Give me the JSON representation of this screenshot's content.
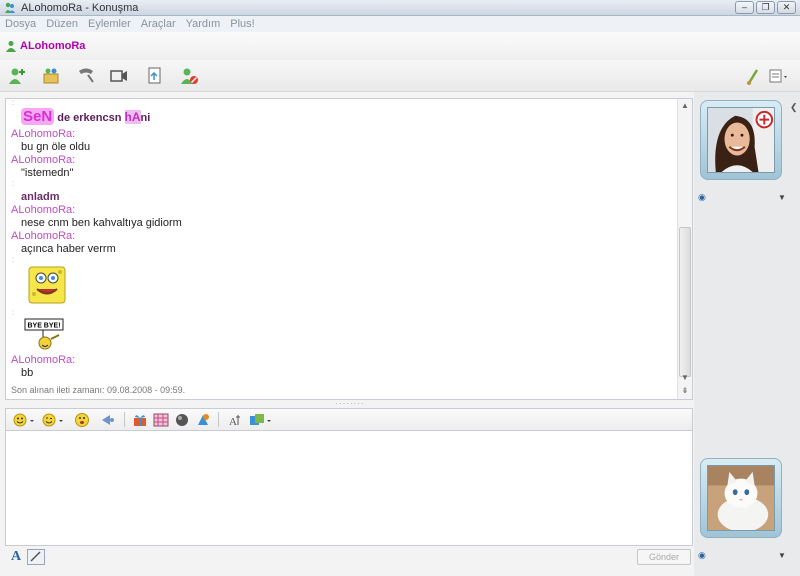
{
  "window": {
    "title": "ALohomoRa - Konuşma"
  },
  "menu": [
    "Dosya",
    "Düzen",
    "Eylemler",
    "Araçlar",
    "Yardım",
    "Plus!"
  ],
  "contact": {
    "name": "ALohomoRa"
  },
  "toolbar": {
    "buttons": [
      "invite-contact",
      "share-files",
      "start-call",
      "video-call",
      "send-file",
      "block-contact"
    ]
  },
  "conversation": {
    "messages": [
      {
        "type": "art",
        "text_art": "SeN",
        "text_rest": " de erkencsn ",
        "text_art2": "hA",
        "text_tail": "ni"
      },
      {
        "type": "sender",
        "text": "ALohomoRa:"
      },
      {
        "type": "msg",
        "text": "bu gn öle oldu"
      },
      {
        "type": "sender",
        "text": "ALohomoRa:"
      },
      {
        "type": "msg",
        "text": "\"istemedn\""
      },
      {
        "type": "msg-bold",
        "text": "anladm"
      },
      {
        "type": "sender",
        "text": "ALohomoRa:"
      },
      {
        "type": "msg",
        "text": "nese cnm ben kahvaltıya gidiorm"
      },
      {
        "type": "sender",
        "text": "ALohomoRa:"
      },
      {
        "type": "msg",
        "text": "açınca haber verrm"
      },
      {
        "type": "sender",
        "text": "ALohomoRa:"
      },
      {
        "type": "msg",
        "text": "bb"
      }
    ],
    "emoticon_sign": "BYE BYE!",
    "last_message_label": "Son alınan ileti zamanı: 09.08.2008 - 09:59."
  },
  "compose": {
    "send_label": "Gönder",
    "font_icon_label": "A"
  },
  "colors": {
    "sender": "#c04cc4",
    "contact_name": "#b000b0"
  }
}
